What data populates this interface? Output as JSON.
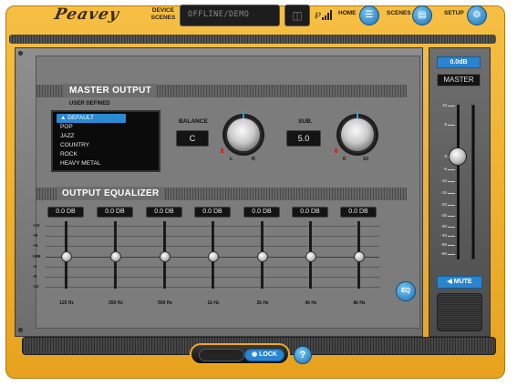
{
  "header": {
    "logo": "Peavey",
    "device_scenes_label": "DEVICE SCENES",
    "lcd_text": "OFFLINE/DEMO",
    "bluetooth_icon": "bluetooth-icon",
    "home_label": "HOME",
    "scenes_label": "SCENES",
    "setup_label": "SETUP"
  },
  "master_output": {
    "title": "MASTER OUTPUT",
    "user_defined_label": "USER DEFINED",
    "presets": [
      "DEFAULT",
      "POP",
      "JAZZ",
      "COUNTRY",
      "ROCK",
      "HEAVY METAL"
    ],
    "selected_preset": "DEFAULT",
    "balance_label": "BALANCE",
    "balance_value": "C",
    "balance_tick_left": "L",
    "balance_tick_right": "R",
    "sub_label": "SUB.",
    "sub_value": "5.0",
    "sub_tick_min": "0",
    "sub_tick_max": "10"
  },
  "output_equalizer": {
    "title": "OUTPUT EQUALIZER",
    "db_scale": [
      "+12",
      "+8",
      "+4",
      "0dB",
      "-4",
      "-8",
      "-12"
    ],
    "bands": [
      {
        "freq": "125 Hz",
        "value": "0.0 DB"
      },
      {
        "freq": "250 Hz",
        "value": "0.0 DB"
      },
      {
        "freq": "500 Hz",
        "value": "0.0 DB"
      },
      {
        "freq": "1k Hz",
        "value": "0.0 DB"
      },
      {
        "freq": "2k Hz",
        "value": "0.0 DB"
      },
      {
        "freq": "4k Hz",
        "value": "0.0 DB"
      },
      {
        "freq": "8k Hz",
        "value": "0.0 DB"
      }
    ],
    "eq_button": "EQ"
  },
  "master_channel": {
    "db_value": "0.0dB",
    "name": "MASTER",
    "scale": [
      "10",
      "5",
      "0",
      "-5",
      "-10",
      "-15",
      "-20",
      "-25",
      "-30",
      "-40",
      "-50",
      "-60"
    ],
    "mute_label": "MUTE"
  },
  "footer": {
    "lock_label": "LOCK",
    "help_label": "?"
  },
  "colors": {
    "frame": "#f0b030",
    "accent_blue": "#2a85d0"
  }
}
